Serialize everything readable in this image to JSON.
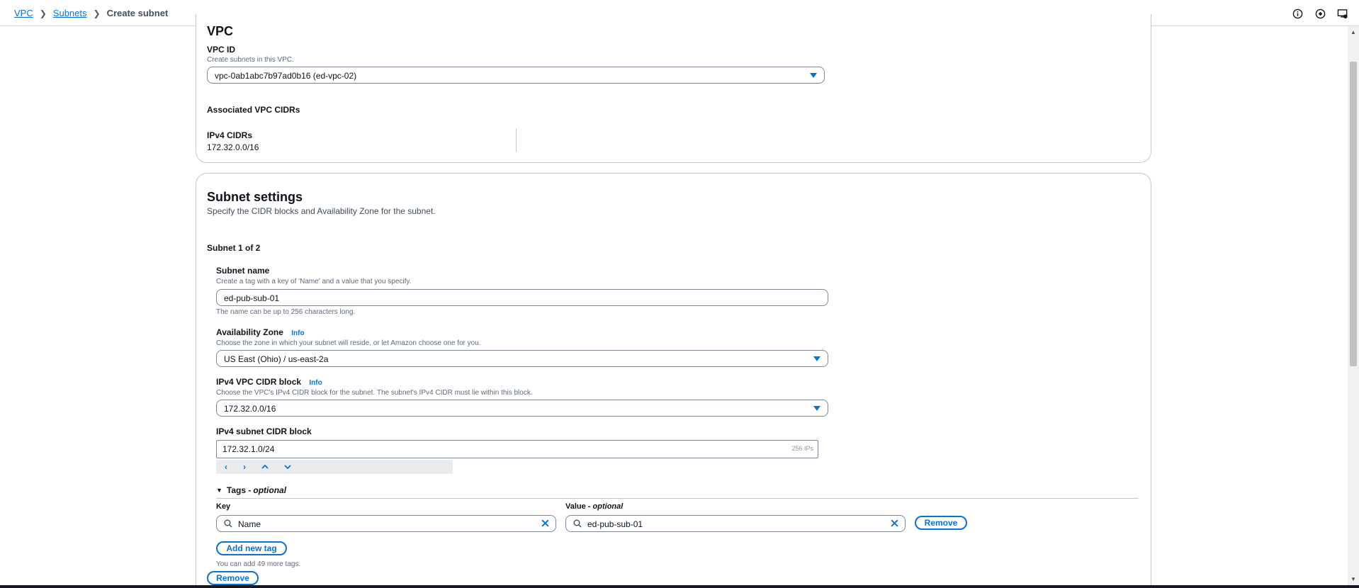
{
  "breadcrumb": {
    "items": [
      "VPC",
      "Subnets"
    ],
    "current": "Create subnet"
  },
  "vpc": {
    "title": "VPC",
    "vpc_id_label": "VPC ID",
    "vpc_id_desc": "Create subnets in this VPC.",
    "vpc_id_value": "vpc-0ab1abc7b97ad0b16 (ed-vpc-02)",
    "associated_label": "Associated VPC CIDRs",
    "ipv4_cidrs_label": "IPv4 CIDRs",
    "ipv4_cidrs_value": "172.32.0.0/16"
  },
  "subnet_settings": {
    "title": "Subnet settings",
    "desc": "Specify the CIDR blocks and Availability Zone for the subnet.",
    "counter": "Subnet 1 of 2",
    "name_label": "Subnet name",
    "name_desc": "Create a tag with a key of 'Name' and a value that you specify.",
    "name_value": "ed-pub-sub-01",
    "name_hint": "The name can be up to 256 characters long.",
    "az_label": "Availability Zone",
    "info_label": "Info",
    "az_desc": "Choose the zone in which your subnet will reside, or let Amazon choose one for you.",
    "az_value": "US East (Ohio) / us-east-2a",
    "vpc_cidr_label": "IPv4 VPC CIDR block",
    "vpc_cidr_desc": "Choose the VPC's IPv4 CIDR block for the subnet. The subnet's IPv4 CIDR must lie within this block.",
    "vpc_cidr_value": "172.32.0.0/16",
    "subnet_cidr_label": "IPv4 subnet CIDR block",
    "subnet_cidr_value": "172.32.1.0/24",
    "subnet_cidr_suffix": "256 IPs",
    "tags_label": "Tags - ",
    "tags_optional": "optional",
    "key_label": "Key",
    "value_label": "Value - ",
    "value_optional": "optional",
    "tag_key": "Name",
    "tag_value": "ed-pub-sub-01",
    "remove_tag_label": "Remove",
    "add_tag_label": "Add new tag",
    "tags_remaining": "You can add 49 more tags.",
    "remove_subnet_label": "Remove"
  },
  "colors": {
    "accent": "#0972d3",
    "border": "#7d8998",
    "muted": "#5f6b7a"
  }
}
